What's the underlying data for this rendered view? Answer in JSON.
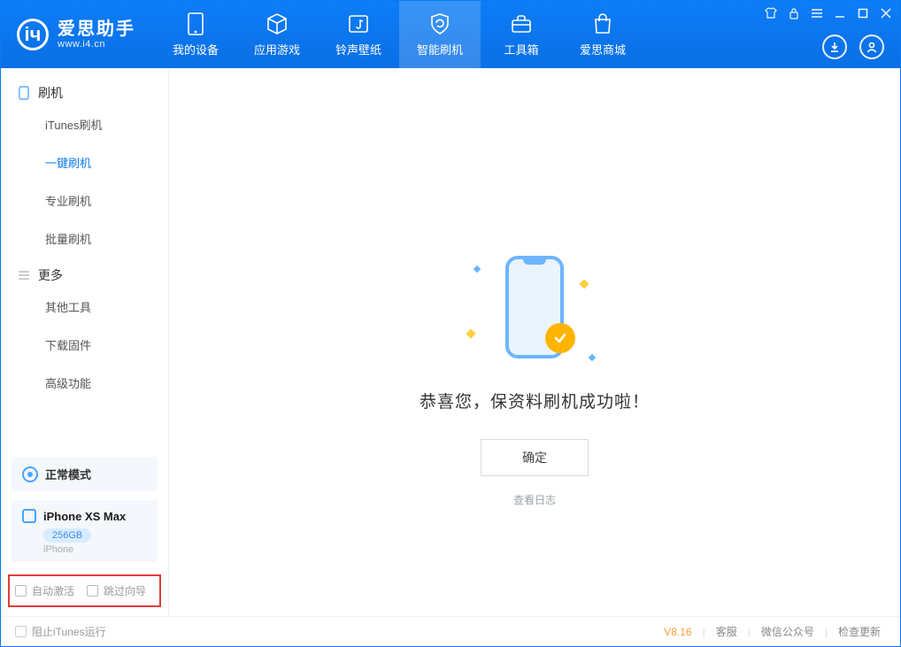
{
  "app": {
    "name_cn": "爱思助手",
    "name_en": "www.i4.cn"
  },
  "header_tabs": {
    "device": "我的设备",
    "apps": "应用游戏",
    "ring": "铃声壁纸",
    "flash": "智能刷机",
    "tools": "工具箱",
    "store": "爱思商城"
  },
  "sidebar": {
    "group_flash": "刷机",
    "items_flash": {
      "itunes": "iTunes刷机",
      "oneclick": "一键刷机",
      "pro": "专业刷机",
      "batch": "批量刷机"
    },
    "group_more": "更多",
    "items_more": {
      "other": "其他工具",
      "download": "下载固件",
      "advanced": "高级功能"
    }
  },
  "device": {
    "mode": "正常模式",
    "name": "iPhone XS Max",
    "storage": "256GB",
    "type": "iPhone"
  },
  "options": {
    "auto_activate": "自动激活",
    "skip_guide": "跳过向导"
  },
  "main": {
    "success_msg": "恭喜您，保资料刷机成功啦！",
    "ok": "确定",
    "view_log": "查看日志"
  },
  "footer": {
    "block_itunes": "阻止iTunes运行",
    "version": "V8.16",
    "service": "客服",
    "wechat": "微信公众号",
    "update": "检查更新"
  }
}
